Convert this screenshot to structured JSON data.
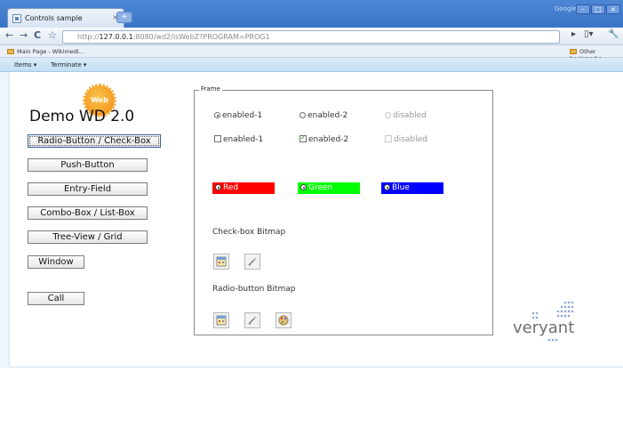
{
  "browser": {
    "tab_title": "Controls sample",
    "tab_close": "×",
    "new_tab": "+",
    "google_label": "Google",
    "url_prefix": "http://",
    "url_host": "127.0.0.1",
    "url_rest": ":8080/wd2/isWebZ?PROGRAM=PROG1",
    "bookmark_main": "Main Page - Wikimedi...",
    "bookmark_other": "Other bookmarks"
  },
  "menubar": {
    "items": [
      "Items ▾",
      "Terminate ▾"
    ]
  },
  "app": {
    "web_badge": "Web",
    "title": "Demo WD 2.0",
    "buttons": [
      "Radio-Button / Check-Box",
      "Push-Button",
      "Entry-Field",
      "Combo-Box / List-Box",
      "Tree-View / Grid",
      "Window",
      "Call"
    ],
    "frame": {
      "label": "Frame",
      "radios": [
        "enabled-1",
        "enabled-2",
        "disabled"
      ],
      "checks": [
        "enabled-1",
        "enabled-2",
        "disabled"
      ],
      "color_radios": [
        {
          "label": "Red",
          "color": "#ff0000",
          "text_color": "#ffffff"
        },
        {
          "label": "Green",
          "color": "#00ff00",
          "text_color": "#ffffff"
        },
        {
          "label": "Blue",
          "color": "#0000ff",
          "text_color": "#ffffff"
        }
      ],
      "checkbox_bitmap_label": "Check-box Bitmap",
      "radio_bitmap_label": "Radio-button Bitmap"
    },
    "logo_text": "veryant"
  }
}
